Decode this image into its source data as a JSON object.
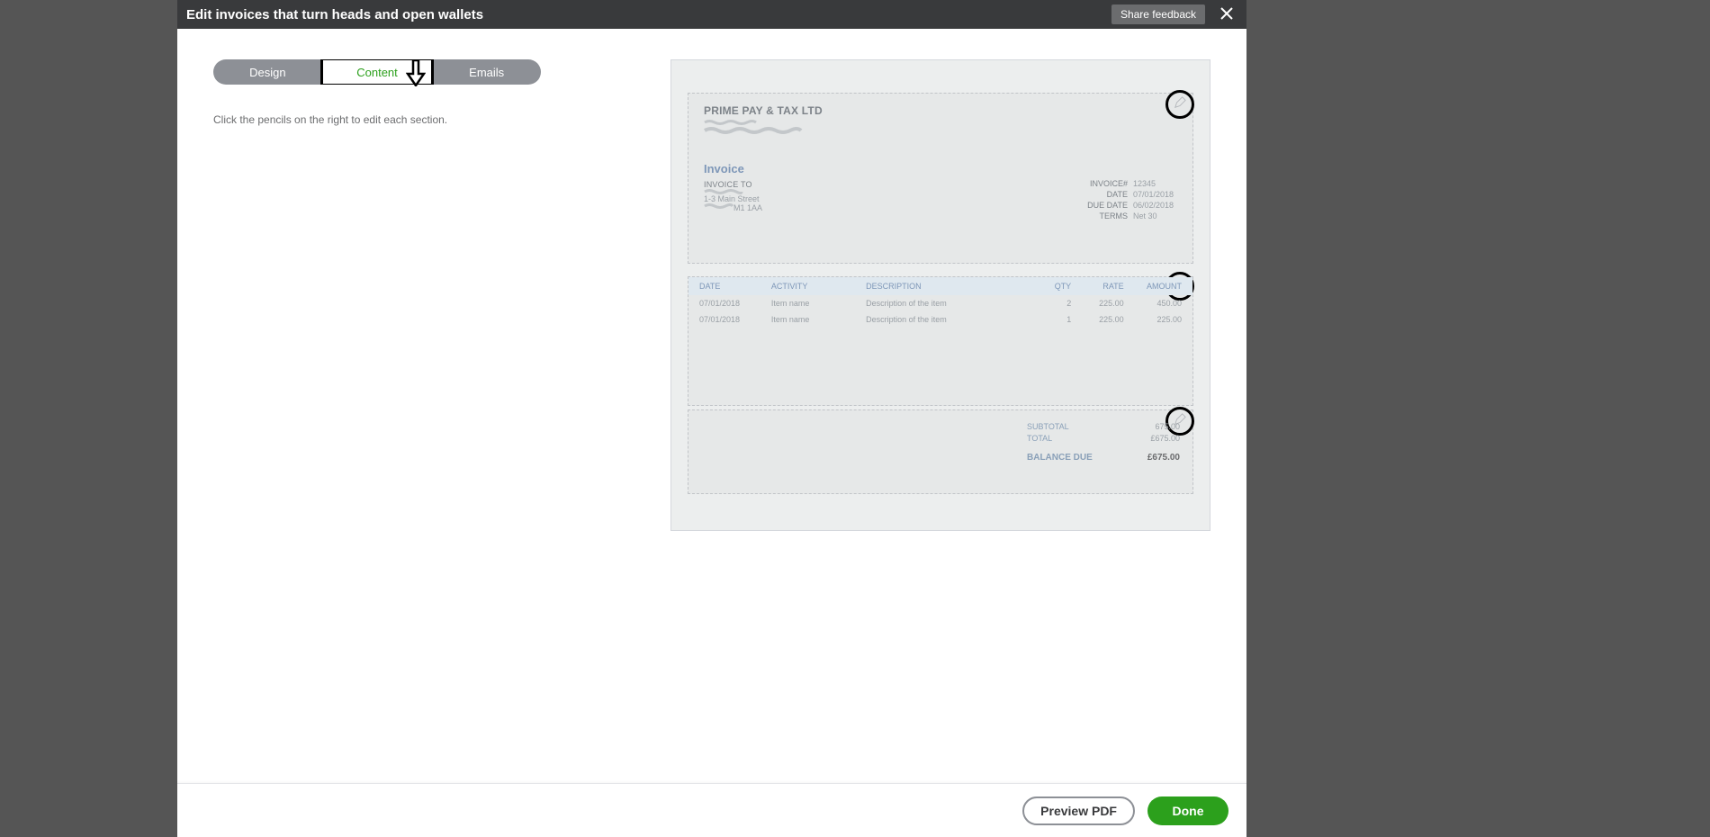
{
  "header": {
    "title": "Edit invoices that turn heads and open wallets",
    "feedback_label": "Share feedback"
  },
  "tabs": {
    "design": "Design",
    "content": "Content",
    "emails": "Emails"
  },
  "hint": "Click the pencils on the right to edit each section.",
  "invoice": {
    "company_name": "PRIME PAY & TAX LTD",
    "title": "Invoice",
    "to_label": "INVOICE TO",
    "addr_line1": "1-3 Main Street",
    "addr_line2": "M1 1AA",
    "meta": {
      "invoice_no_label": "INVOICE#",
      "invoice_no": "12345",
      "date_label": "DATE",
      "date": "07/01/2018",
      "due_label": "DUE DATE",
      "due": "06/02/2018",
      "terms_label": "TERMS",
      "terms": "Net 30"
    }
  },
  "table": {
    "headers": {
      "date": "DATE",
      "activity": "ACTIVITY",
      "description": "DESCRIPTION",
      "qty": "QTY",
      "rate": "RATE",
      "amount": "AMOUNT"
    },
    "rows": [
      {
        "date": "07/01/2018",
        "activity": "Item name",
        "description": "Description of the item",
        "qty": "2",
        "rate": "225.00",
        "amount": "450.00"
      },
      {
        "date": "07/01/2018",
        "activity": "Item name",
        "description": "Description of the item",
        "qty": "1",
        "rate": "225.00",
        "amount": "225.00"
      }
    ]
  },
  "totals": {
    "subtotal_label": "SUBTOTAL",
    "subtotal": "675.00",
    "total_label": "TOTAL",
    "total": "£675.00",
    "balance_label": "BALANCE DUE",
    "balance": "£675.00"
  },
  "footer": {
    "preview": "Preview PDF",
    "done": "Done"
  }
}
